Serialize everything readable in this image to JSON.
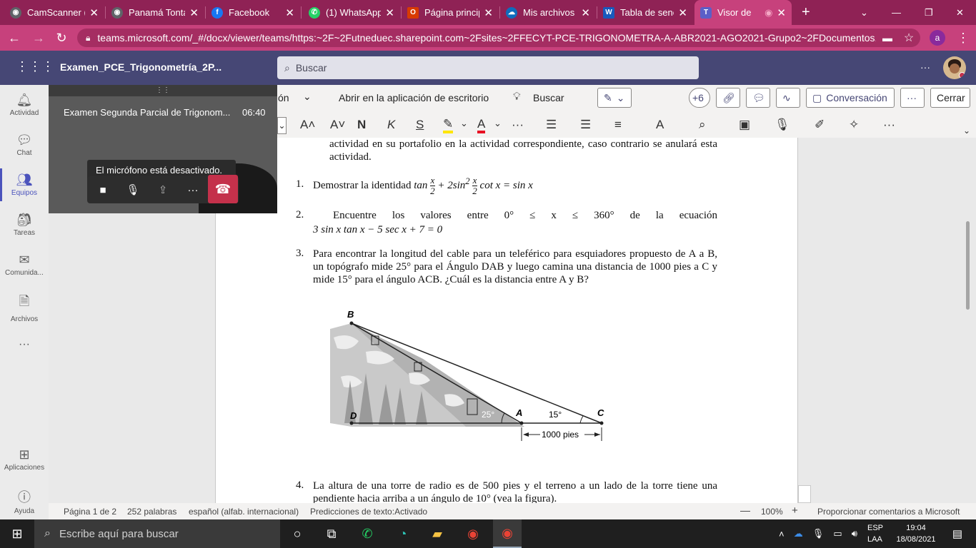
{
  "browser": {
    "tabs": [
      {
        "label": "CamScanner (",
        "icon": "camscanner-icon",
        "color": "#5f6368"
      },
      {
        "label": "Panamá Tonta",
        "icon": "globe-icon",
        "color": "#5f6368"
      },
      {
        "label": "Facebook",
        "icon": "facebook-icon",
        "color": "#1877f2"
      },
      {
        "label": "(1) WhatsApp",
        "icon": "whatsapp-icon",
        "color": "#25d366"
      },
      {
        "label": "Página princip",
        "icon": "office-icon",
        "color": "#d83b01"
      },
      {
        "label": "Mis archivos -",
        "icon": "onedrive-icon",
        "color": "#0f6cbd"
      },
      {
        "label": "Tabla de seno",
        "icon": "word-icon",
        "color": "#185abd"
      },
      {
        "label": "Visor de",
        "icon": "teams-icon",
        "color": "#5b5fc7"
      }
    ],
    "new_tab": "+",
    "url": "teams.microsoft.com/_#/docx/viewer/teams/https:~2F~2Futneduec.sharepoint.com~2Fsites~2FFECYT-PCE-TRIGONOMETRA-A-ABR2021-AGO2021-Grupo2~2FDocumentos...",
    "profile_initial": "a"
  },
  "teams": {
    "app_title": "Examen_PCE_Trigonometría_2P...",
    "search_placeholder": "Buscar",
    "more": "···",
    "rail": [
      {
        "label": "Actividad",
        "icon": "bell-icon"
      },
      {
        "label": "Chat",
        "icon": "chat-icon"
      },
      {
        "label": "Equipos",
        "icon": "teams-people-icon"
      },
      {
        "label": "Tareas",
        "icon": "assignments-icon"
      },
      {
        "label": "Comunida...",
        "icon": "communities-icon"
      },
      {
        "label": "Archivos",
        "icon": "file-icon"
      },
      {
        "label": "···",
        "icon": "more-icon"
      },
      {
        "label": "Aplicaciones",
        "icon": "apps-icon"
      },
      {
        "label": "Ayuda",
        "icon": "help-icon"
      }
    ]
  },
  "word": {
    "menu_partial": "ón",
    "open_desktop": "Abrir en la aplicación de escritorio",
    "search": "Buscar",
    "participants": "+6",
    "conversation": "Conversación",
    "more": "···",
    "close": "Cerrar",
    "format_tools": [
      "A˄",
      "A˅",
      "N",
      "K",
      "S"
    ]
  },
  "document": {
    "intro": "actividad en su portafolio en la actividad correspondiente, caso contrario se anulará esta actividad.",
    "q1_num": "1.",
    "q1": "Demostrar la identidad",
    "q2_num": "2.",
    "q2": "Encuentre los valores entre 0° ≤ x ≤ 360° de la ecuación",
    "q2_eq": "3 sin x tan x − 5 sec x + 7 = 0",
    "q3_num": "3.",
    "q3": "Para encontrar la longitud del cable para un teleférico para esquiadores propuesto de A a B, un topógrafo mide 25° para el Ángulo DAB y luego camina una distancia de 1000 pies a C y mide 15° para el ángulo ACB. ¿Cuál es la distancia entre A y B?",
    "figure": {
      "B": "B",
      "D": "D",
      "A": "A",
      "C": "C",
      "angle_a": "25°",
      "angle_c": "15°",
      "distance": "1000 pies"
    },
    "q4_num": "4.",
    "q4": "La altura de una torre de radio es de 500 pies y el terreno a un lado de la torre tiene una pendiente hacia arriba a un ángulo de 10° (vea la figura)."
  },
  "status": {
    "page": "Página 1 de 2",
    "words": "252 palabras",
    "language": "español (alfab. internacional)",
    "predictions": "Predicciones de texto:Activado",
    "zoom": "100%",
    "feedback": "Proporcionar comentarios a Microsoft"
  },
  "meeting": {
    "title": "Examen Segunda Parcial de Trigonom...",
    "time": "06:40",
    "mic_message": "El micrófono está desactivado."
  },
  "taskbar": {
    "search_placeholder": "Escribe aquí para buscar",
    "lang": "ESP",
    "lang2": "LAA",
    "time": "19:04",
    "date": "18/08/2021"
  }
}
